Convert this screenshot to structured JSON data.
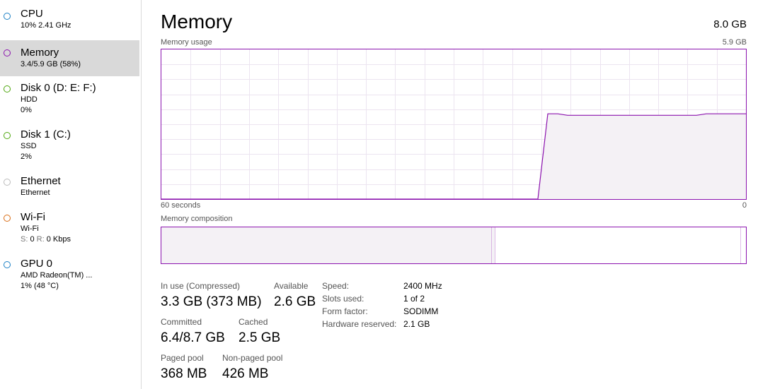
{
  "sidebar": {
    "items": [
      {
        "name": "CPU",
        "sub1": "10% 2.41 GHz",
        "color": "#1a7fc4",
        "selected": false
      },
      {
        "name": "Memory",
        "sub1": "3.4/5.9 GB (58%)",
        "color": "#8b12ae",
        "selected": true
      },
      {
        "name": "Disk 0 (D: E: F:)",
        "sub1": "HDD",
        "sub2": "0%",
        "color": "#4da60c"
      },
      {
        "name": "Disk 1 (C:)",
        "sub1": "SSD",
        "sub2": "2%",
        "color": "#4da60c"
      },
      {
        "name": "Ethernet",
        "sub1": "Ethernet",
        "color": "#bbbbbb"
      },
      {
        "name": "Wi-Fi",
        "sub1": "Wi-Fi",
        "sub2_s_label": "S:",
        "sub2_s_value": "0",
        "sub2_r_label": "R:",
        "sub2_r_value": "0 Kbps",
        "color": "#d86b13"
      },
      {
        "name": "GPU 0",
        "sub1": "AMD Radeon(TM) ...",
        "sub2": "1% (48 °C)",
        "color": "#1a7fc4"
      }
    ]
  },
  "main": {
    "title": "Memory",
    "total": "8.0 GB",
    "usage_label": "Memory usage",
    "usage_max": "5.9 GB",
    "time_left": "60 seconds",
    "time_right": "0",
    "composition_label": "Memory composition",
    "accent": "#8b12ae",
    "usage_series_fraction": [
      0,
      0,
      0,
      0,
      0,
      0,
      0,
      0,
      0,
      0,
      0,
      0,
      0,
      0,
      0,
      0,
      0,
      0,
      0,
      0,
      0,
      0,
      0,
      0,
      0,
      0,
      0,
      0,
      0,
      0,
      0,
      0,
      0,
      0,
      0,
      0,
      0,
      0,
      0,
      0.57,
      0.57,
      0.56,
      0.56,
      0.56,
      0.56,
      0.56,
      0.56,
      0.56,
      0.56,
      0.56,
      0.56,
      0.56,
      0.56,
      0.56,
      0.56,
      0.57,
      0.57,
      0.57,
      0.57,
      0.57
    ],
    "composition": {
      "in_use_fraction": 0.565,
      "modified_fraction": 0.006,
      "standby_fraction": 0.42,
      "free_fraction": 0.009
    }
  },
  "stats": {
    "in_use_label": "In use (Compressed)",
    "in_use_value": "3.3 GB (373 MB)",
    "available_label": "Available",
    "available_value": "2.6 GB",
    "committed_label": "Committed",
    "committed_value": "6.4/8.7 GB",
    "cached_label": "Cached",
    "cached_value": "2.5 GB",
    "paged_label": "Paged pool",
    "paged_value": "368 MB",
    "nonpaged_label": "Non-paged pool",
    "nonpaged_value": "426 MB"
  },
  "specs": [
    {
      "label": "Speed:",
      "value": "2400 MHz"
    },
    {
      "label": "Slots used:",
      "value": "1 of 2"
    },
    {
      "label": "Form factor:",
      "value": "SODIMM"
    },
    {
      "label": "Hardware reserved:",
      "value": "2.1 GB"
    }
  ]
}
